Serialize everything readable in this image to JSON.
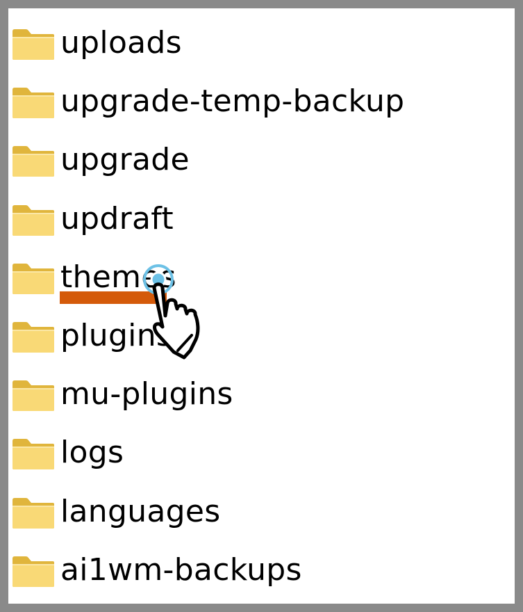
{
  "folders": [
    {
      "name": "uploads"
    },
    {
      "name": "upgrade-temp-backup"
    },
    {
      "name": "upgrade"
    },
    {
      "name": "updraft"
    },
    {
      "name": "themes"
    },
    {
      "name": "plugins"
    },
    {
      "name": "mu-plugins"
    },
    {
      "name": "logs"
    },
    {
      "name": "languages"
    },
    {
      "name": "ai1wm-backups"
    }
  ],
  "highlighted_folder": "themes",
  "icons": {
    "folder": "folder-icon",
    "pointer": "hand-pointer-icon"
  },
  "colors": {
    "frame": "#8a8a8a",
    "folder_fill": "#f9d976",
    "folder_edge": "#e0b53c",
    "highlight": "#d45a0a",
    "click_ring": "#6cc1e6"
  }
}
